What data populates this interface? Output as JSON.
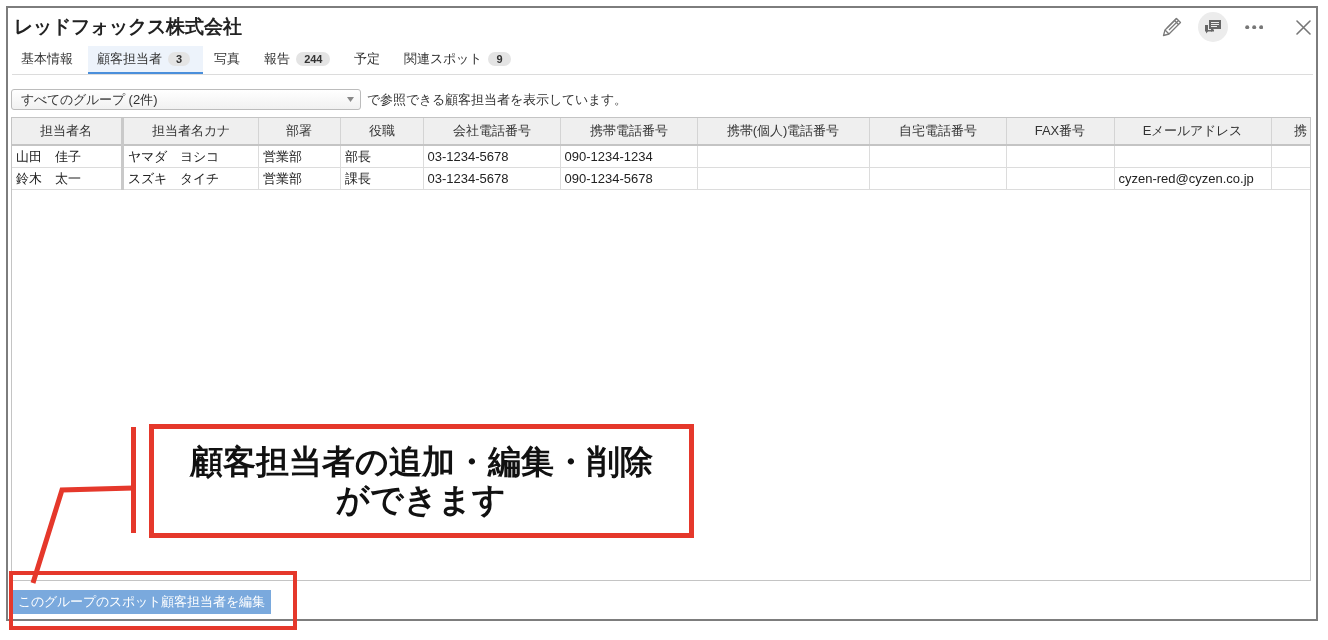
{
  "window": {
    "title": "レッドフォックス株式会社"
  },
  "toolbar": [
    {
      "kind": "edit",
      "active": false
    },
    {
      "kind": "comments",
      "active": true
    },
    {
      "kind": "more",
      "active": false
    },
    {
      "kind": "close",
      "active": false
    }
  ],
  "tabs": [
    {
      "label": "基本情報",
      "selected": false
    },
    {
      "label": "顧客担当者",
      "count": "3",
      "selected": true
    },
    {
      "label": "写真",
      "selected": false
    },
    {
      "label": "報告",
      "count": "244",
      "selected": false
    },
    {
      "label": "予定",
      "selected": false
    },
    {
      "label": "関連スポット",
      "count": "9",
      "selected": false
    }
  ],
  "group_filter": {
    "value": "すべてのグループ (2件)",
    "caption": "で参照できる顧客担当者を表示しています。"
  },
  "table": {
    "columns": [
      "担当者名",
      "担当者名カナ",
      "部署",
      "役職",
      "会社電話番号",
      "携帯電話番号",
      "携帯(個人)電話番号",
      "自宅電話番号",
      "FAX番号",
      "Eメールアドレス",
      "携"
    ],
    "rows": [
      [
        "山田　佳子",
        "ヤマダ　ヨシコ",
        "営業部",
        "部長",
        "03-1234-5678",
        "090-1234-1234"
      ],
      [
        "鈴木　太一",
        "スズキ　タイチ",
        "営業部",
        "課長",
        "03-1234-5678",
        "090-1234-5678",
        null,
        null,
        null,
        "cyzen-red@cyzen.co.jp"
      ]
    ]
  },
  "footer": {
    "button": "このグループのスポット顧客担当者を編集"
  },
  "annotation": {
    "text": "顧客担当者の追加・編集・削除ができます"
  }
}
